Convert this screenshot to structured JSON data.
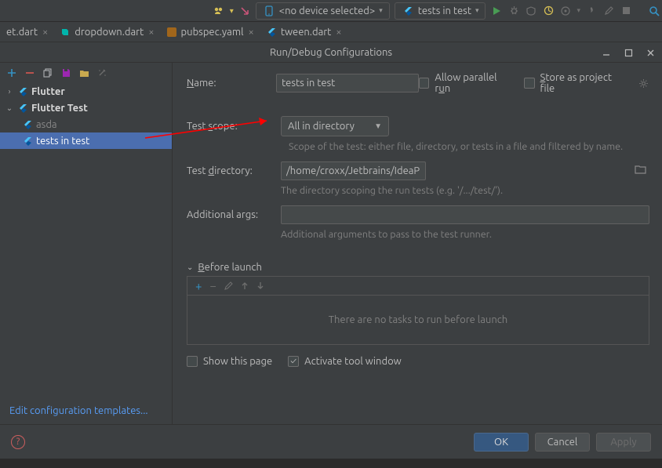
{
  "toolbar": {
    "device_label": "<no device selected>",
    "run_config_label": "tests in test"
  },
  "editor_tabs": [
    {
      "name": "et.dart",
      "icon": "dart"
    },
    {
      "name": "dropdown.dart",
      "icon": "dart"
    },
    {
      "name": "pubspec.yaml",
      "icon": "yaml"
    },
    {
      "name": "tween.dart",
      "icon": "flutter"
    }
  ],
  "dialog": {
    "title": "Run/Debug Configurations"
  },
  "tree": {
    "nodes": [
      "Flutter",
      "Flutter Test"
    ],
    "children": [
      "asda",
      "tests in test"
    ]
  },
  "edit_templates": "Edit configuration templates...",
  "form": {
    "name_label": "Name:",
    "name_value": "tests in test",
    "allow_parallel": "Allow parallel run",
    "store_project": "Store as project file",
    "scope_label": "Test scope:",
    "scope_value": "All in directory",
    "scope_hint": "Scope of the test: either file, directory, or tests in a file and filtered by name.",
    "dir_label": "Test directory:",
    "dir_value": "/home/croxx/Jetbrains/IdeaProjects/stack_overflow/test/",
    "dir_hint": "The directory scoping the run tests (e.g. '/.../test/').",
    "args_label": "Additional args:",
    "args_value": "",
    "args_hint": "Additional arguments to pass to the test runner.",
    "before_launch": "Before launch",
    "no_tasks": "There are no tasks to run before launch",
    "show_page": "Show this page",
    "activate_tool": "Activate tool window"
  },
  "footer": {
    "ok": "OK",
    "cancel": "Cancel",
    "apply": "Apply"
  }
}
